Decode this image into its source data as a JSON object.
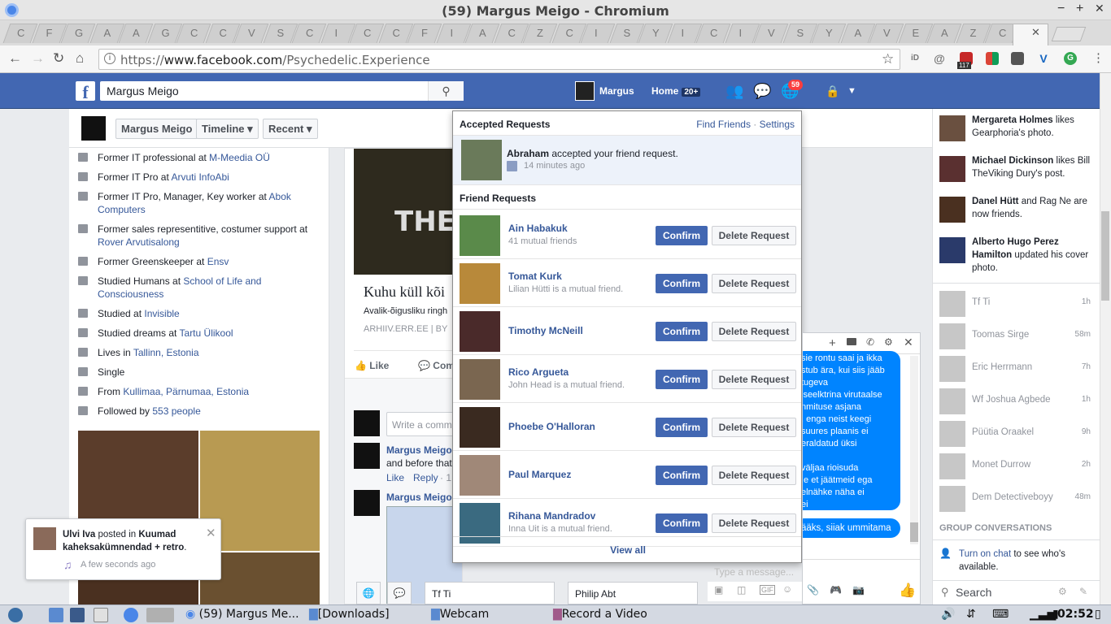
{
  "window": {
    "title": "(59) Margus Meigo - Chromium",
    "min": "−",
    "max": "+",
    "close": "✕"
  },
  "tabs": {
    "glyphs": [
      "C",
      "F",
      "G",
      "A",
      "A",
      "G",
      "C",
      "C",
      "V",
      "S",
      "C",
      "I",
      "C",
      "C",
      "F",
      "I",
      "A",
      "C",
      "Z",
      "C",
      "I",
      "S",
      "Y",
      "I",
      "C",
      "I",
      "V",
      "S",
      "Y",
      "A",
      "V",
      "E",
      "A",
      "Z",
      "C"
    ]
  },
  "address": {
    "scheme": "https://",
    "host": "www.facebook.com",
    "path": "/Psychedelic.Experience",
    "ext_badge": "117"
  },
  "fb": {
    "search_value": "Margus Meigo",
    "user_name": "Margus",
    "home_label": "Home",
    "home_badge": "20+",
    "notif_badge": "59"
  },
  "profile_header": {
    "name_btn": "Margus Meigo",
    "timeline_btn": "Timeline",
    "recent_btn": "Recent"
  },
  "intro": [
    {
      "pre": "Former IT professional at ",
      "link": "M-Meedia OÜ"
    },
    {
      "pre": "Former IT Pro at ",
      "link": "Arvuti InfoAbi"
    },
    {
      "pre": "Former IT Pro, Manager, Key worker at ",
      "link": "Abok Computers"
    },
    {
      "pre": "Former sales representitive, costumer support at ",
      "link": "Rover Arvutisalong"
    },
    {
      "pre": "Former Greenskeeper at ",
      "link": "Ensv"
    },
    {
      "pre": "Studied Humans at ",
      "link": "School of Life and Consciousness"
    },
    {
      "pre": "Studied at ",
      "link": "Invisible"
    },
    {
      "pre": "Studied dreams at ",
      "link": "Tartu Ülikool"
    },
    {
      "pre": "Lives in ",
      "link": "Tallinn, Estonia"
    },
    {
      "pre": "Single",
      "link": ""
    },
    {
      "pre": "From ",
      "link": "Kullimaa, Pärnumaa, Estonia"
    },
    {
      "pre": "Followed by ",
      "link": "553 people"
    }
  ],
  "center": {
    "article_title": "Kuhu küll kõi",
    "article_desc": "Avalik-õigusliku ringh",
    "article_source": "ARHIIV.ERR.EE",
    "article_by": "| BY",
    "like": "Like",
    "comment": "Com",
    "write_placeholder": "Write a comm",
    "c1_name": "Margus Meigo",
    "c1_text": "and before that",
    "c1_like": "Like",
    "c1_reply": "Reply",
    "c1_time": "· 1",
    "c2_name": "Margus Meigo"
  },
  "dropdown": {
    "accepted_header": "Accepted Requests",
    "find_friends": "Find Friends",
    "settings": "Settings",
    "dot": "·",
    "accepted_name": "Abraham",
    "accepted_text": " accepted your friend request.",
    "accepted_time": "14 minutes ago",
    "requests_header": "Friend Requests",
    "confirm": "Confirm",
    "delete": "Delete Request",
    "view_all": "View all",
    "requests": [
      {
        "name": "Ain Habakuk",
        "sub": "41 mutual friends",
        "color": "#5a8a4a"
      },
      {
        "name": "Tomat Kurk",
        "sub": "Lilian Hütti is a mutual friend.",
        "color": "#b8893a"
      },
      {
        "name": "Timothy McNeill",
        "sub": "",
        "color": "#4a2a2a"
      },
      {
        "name": "Rico Argueta",
        "sub": "John Head is a mutual friend.",
        "color": "#7a6650"
      },
      {
        "name": "Phoebe O'Halloran",
        "sub": "",
        "color": "#3a2a20"
      },
      {
        "name": "Paul Marquez",
        "sub": "",
        "color": "#a08878"
      },
      {
        "name": "Rihana Mandradov",
        "sub": "Inna Uit is a mutual friend.",
        "color": "#3a6a80"
      }
    ]
  },
  "ticker": [
    {
      "name": "Mergareta Holmes",
      "text": " likes Gearphoria's photo.",
      "color": "#6a5040"
    },
    {
      "name": "Michael Dickinson",
      "text": " likes Bill TheViking Dury's post.",
      "color": "#5a3030"
    },
    {
      "name": "Danel Hütt",
      "text": " and Rag Ne are now friends.",
      "color": "#4a3020"
    },
    {
      "name": "Alberto Hugo Perez Hamilton",
      "text": " updated his cover photo.",
      "color": "#2a3a6a"
    }
  ],
  "chat_list": [
    {
      "name": "Tf Ti",
      "time": "1h"
    },
    {
      "name": "Toomas Sirge",
      "time": "58m"
    },
    {
      "name": "Eric Herrmann",
      "time": "7h"
    },
    {
      "name": "Wf Joshua Agbede",
      "time": "1h"
    },
    {
      "name": "Püütia Oraakel",
      "time": "9h"
    },
    {
      "name": "Monet Durrow",
      "time": "2h"
    },
    {
      "name": "Dem Detectiveboyy",
      "time": "48m"
    }
  ],
  "group_conv": "GROUP CONVERSATIONS",
  "turn_on_chat": "Turn on chat",
  "turn_on_chat_rest": " to see who's available.",
  "chat_search": "Search",
  "messenger": {
    "lines": [
      "sie rontu saai ja ikka",
      "stub ära, kui siis jääb",
      "tugeva",
      "iseelktrina virutaalse",
      "nmituse asjana",
      ", enga neist keegi",
      "suures plaanis ei",
      "eraldatud üksi",
      "",
      "väljaa rioisuda",
      ",e et jäätmeid ega",
      "elnähke näha ei",
      "ei"
    ],
    "bubble2": "ääks, siiak ummitama",
    "type_placeholder": "Type a message..."
  },
  "bottom_chats": {
    "a": "Tf Ti",
    "b": "Philip Abt"
  },
  "toast": {
    "name": "Ulvi Iva",
    "mid": " posted in ",
    "group": "Kuumad kaheksakümnendad + retro",
    "end": ".",
    "time": "A few seconds ago"
  },
  "taskbar": {
    "chromium": "(59) Margus Me...",
    "downloads": "[Downloads]",
    "webcam": "Webcam",
    "record": "Record a Video",
    "clock": "02:52"
  }
}
